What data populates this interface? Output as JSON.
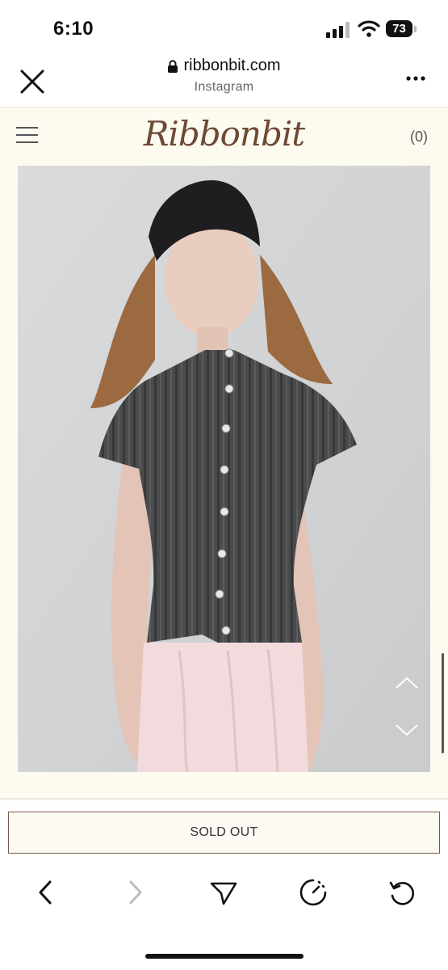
{
  "status_bar": {
    "time": "6:10",
    "battery": "73"
  },
  "browser": {
    "domain": "ribbonbit.com",
    "source": "Instagram"
  },
  "site": {
    "brand": "Ribbonbit",
    "cart_count": "(0)",
    "product_image_alt": "Model wearing ribbed short-sleeve button cardigan"
  },
  "actions": {
    "sold_out_label": "SOLD OUT"
  },
  "colors": {
    "brand": "#6e4a36",
    "site_background": "#fdfaf0",
    "border": "#7a5a4a"
  },
  "icons": [
    "close-icon",
    "lock-icon",
    "more-icon",
    "menu-icon",
    "chevron-up-icon",
    "chevron-down-icon",
    "back-icon",
    "forward-icon",
    "share-icon",
    "speed-icon",
    "reload-icon"
  ]
}
